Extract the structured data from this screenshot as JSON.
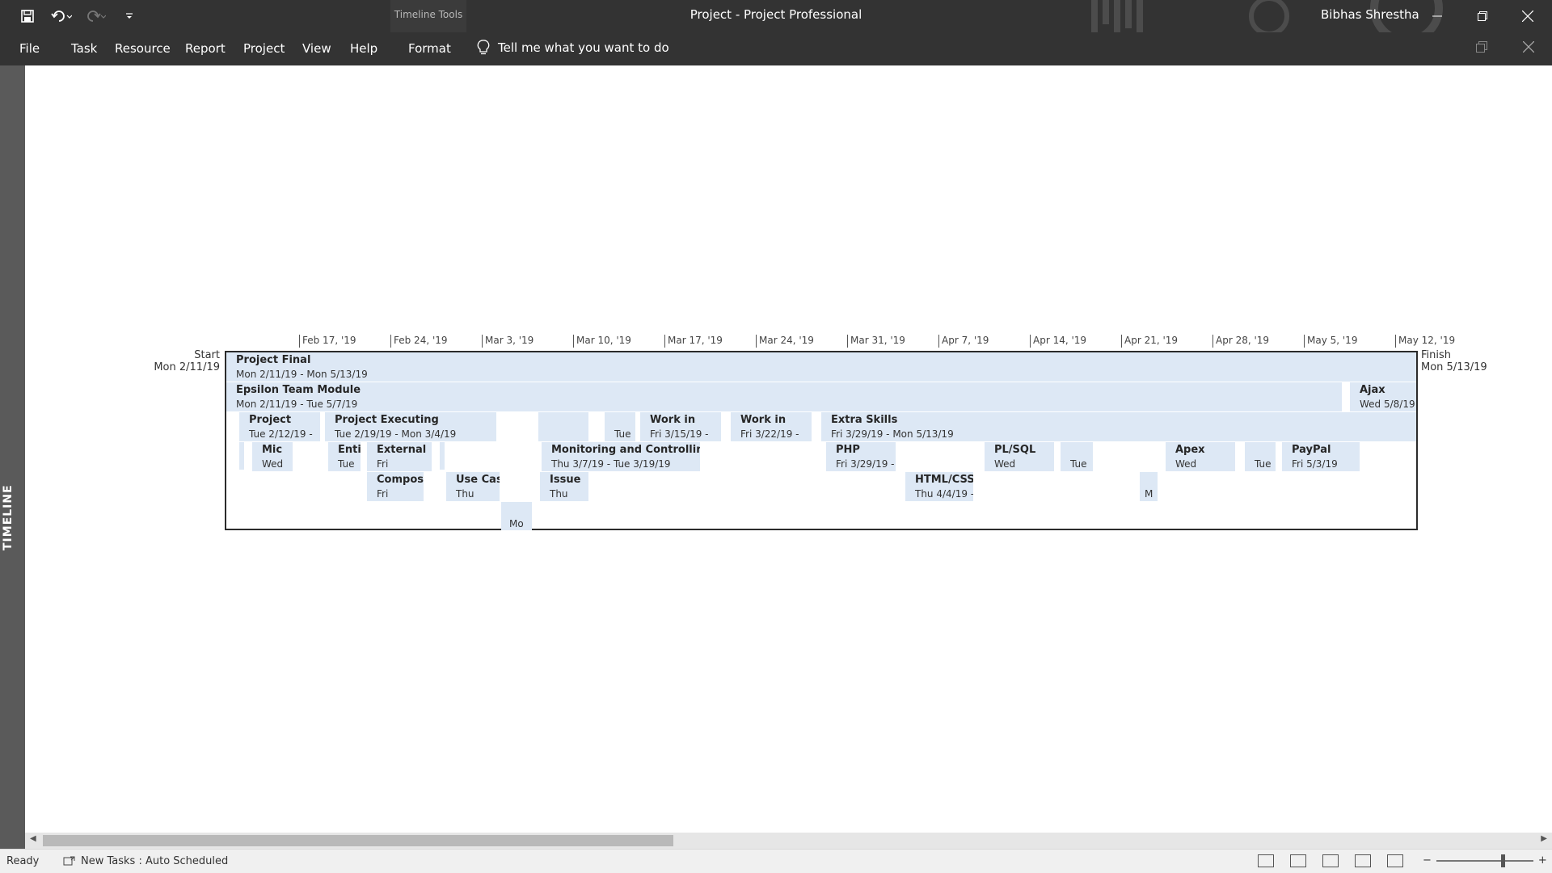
{
  "window": {
    "title": "Project  -  Project Professional",
    "context_tab_group": "Timeline Tools",
    "user": "Bibhas Shrestha"
  },
  "ribbon": {
    "tabs": [
      "File",
      "Task",
      "Resource",
      "Report",
      "Project",
      "View",
      "Help",
      "Format"
    ],
    "tell_me": "Tell me what you want to do"
  },
  "side_panel": {
    "label": "TIMELINE"
  },
  "timeline": {
    "scale": [
      "Feb 17, '19",
      "Feb 24, '19",
      "Mar 3, '19",
      "Mar 10, '19",
      "Mar 17, '19",
      "Mar 24, '19",
      "Mar 31, '19",
      "Apr 7, '19",
      "Apr 14, '19",
      "Apr 21, '19",
      "Apr 28, '19",
      "May 5, '19",
      "May 12, '19"
    ],
    "start_label": "Start",
    "start_date": "Mon 2/11/19",
    "finish_label": "Finish",
    "finish_date": "Mon 5/13/19",
    "bars": [
      {
        "name": "Project Final",
        "date": "Mon 2/11/19 - Mon 5/13/19"
      },
      {
        "name": "Epsilon Team Module",
        "date": "Mon 2/11/19 - Tue 5/7/19"
      },
      {
        "name": "Ajax",
        "date": "Wed 5/8/19"
      },
      {
        "name": "Project",
        "date": "Tue 2/12/19 -"
      },
      {
        "name": "Project Executing",
        "date": "Tue 2/19/19 - Mon 3/4/19"
      },
      {
        "name": "",
        "date": "Tue"
      },
      {
        "name": "Work in",
        "date": "Fri 3/15/19 -"
      },
      {
        "name": "Work in",
        "date": "Fri 3/22/19 -"
      },
      {
        "name": "Extra Skills",
        "date": "Fri 3/29/19 - Mon 5/13/19"
      },
      {
        "name": "Mic",
        "date": "Wed"
      },
      {
        "name": "Enti",
        "date": "Tue"
      },
      {
        "name": "External",
        "date": "Fri"
      },
      {
        "name": "Monitoring and Controlling",
        "date": "Thu 3/7/19 - Tue 3/19/19"
      },
      {
        "name": "PHP",
        "date": "Fri 3/29/19 -"
      },
      {
        "name": "PL/SQL",
        "date": "Wed"
      },
      {
        "name": "",
        "date": "Tue"
      },
      {
        "name": "Apex",
        "date": "Wed"
      },
      {
        "name": "",
        "date": "Tue"
      },
      {
        "name": "PayPal",
        "date": "Fri 5/3/19"
      },
      {
        "name": "Composi",
        "date": "Fri"
      },
      {
        "name": "Use Case",
        "date": "Thu"
      },
      {
        "name": "Issue",
        "date": "Thu"
      },
      {
        "name": "HTML/CSS",
        "date": "Thu 4/4/19 -"
      },
      {
        "name": "",
        "date": "M"
      },
      {
        "name": "",
        "date": "Mo"
      }
    ]
  },
  "status": {
    "ready": "Ready",
    "new_tasks": "New Tasks : Auto Scheduled"
  }
}
